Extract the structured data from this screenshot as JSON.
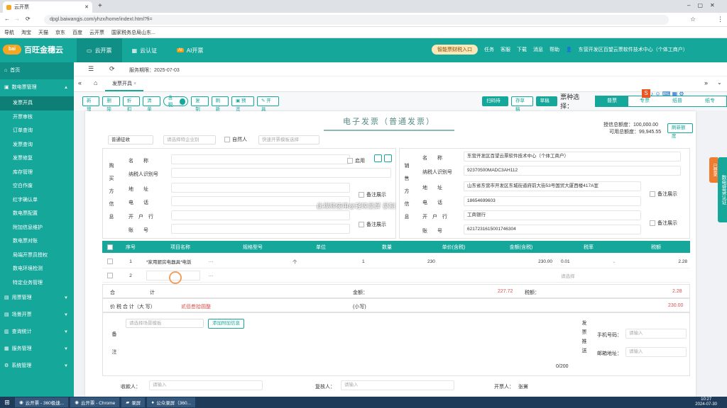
{
  "browser": {
    "tab_title": "云开票",
    "url": "dpgl.baiwangjs.com/yhzx/home/indexI.html?fi=",
    "bookmarks": [
      "导航",
      "淘宝",
      "天猫",
      "京东",
      "百度",
      "云开票",
      "国家税务总局山东..."
    ]
  },
  "app": {
    "logo_badge": "bai",
    "logo": "百旺金穗云",
    "nav": [
      "云开票",
      "云认证",
      "AI开票"
    ],
    "ai_tag": "AI",
    "smart_button": "智能票财税入口",
    "header_links": [
      "任务",
      "客服",
      "下载",
      "消息",
      "帮助"
    ],
    "company": "东营开发区百望云票软件技术中心（个体工商户）"
  },
  "sidebar": {
    "home": "首页",
    "groups": [
      {
        "label": "数电票管理",
        "items": [
          "发票开具",
          "开票审核",
          "订单查询",
          "发票查询",
          "发票修复",
          "库存管理",
          "空白作废",
          "红字确认单",
          "数电票配置",
          "附加信息维护",
          "数电票对账",
          "局端开票员授权",
          "数电环境检测",
          "特定业务管理"
        ]
      },
      {
        "label": "用票管理"
      },
      {
        "label": "场景开票"
      },
      {
        "label": "查询统计"
      },
      {
        "label": "服务管理"
      },
      {
        "label": "系统管理"
      }
    ]
  },
  "service": {
    "expiry": "服务期限：2025-07-03"
  },
  "tabs": {
    "active": "发票开具"
  },
  "toolbar": {
    "buttons": [
      "新增",
      "删除",
      "折扣",
      "清单"
    ],
    "toggle": "含税",
    "more": [
      "复制",
      "刷新"
    ],
    "preview": "预览",
    "issue": "开具",
    "right": [
      "扫码待开",
      "存草稿",
      "草稿箱"
    ],
    "kind_label": "票种选择：",
    "kinds": [
      "普票",
      "专票",
      "纸普",
      "纸专"
    ]
  },
  "invoice": {
    "title": "电子发票（普通发票）",
    "credit_total": "授信总额度：100,000.00",
    "credit_avail": "可用总额度：99,945.55",
    "refresh": "刷新额度",
    "levy": "普通征收",
    "company_select": "请选择特企业别",
    "natural_person": "自然人",
    "template_select": "快速开票模板选择",
    "buyer": {
      "section": "购买方信息",
      "fields": [
        "名　　称",
        "纳税人识别号",
        "地　　址",
        "电　　话",
        "开　户　行",
        "账　　号"
      ],
      "use_label": "启用",
      "note": "备注展示"
    },
    "seller": {
      "section": "销售方信息",
      "name": "东营开发区百望云票软件技术中心（个体工商户）",
      "taxid": "92370500MADC3AH112",
      "address": "山东省东营市开发区东城街道府前大街53号国贸大厦西楼417A室",
      "phone": "18654699603",
      "bank": "工商银行",
      "account": "6217231615001746304",
      "fields": [
        "名　　称",
        "纳税人识别号",
        "地　　址",
        "电　　话",
        "开　户　行",
        "账　　号"
      ]
    },
    "watermark": "此视频使用@轻映录屏 录制",
    "columns": [
      "序号",
      "项目名称",
      "规格型号",
      "单位",
      "数量",
      "单价(含税)",
      "金额(含税)",
      "税率",
      "税额"
    ],
    "rows": [
      {
        "no": "1",
        "name": "*家用厨房电器具*电饭",
        "spec": "",
        "unit": "个",
        "qty": "1",
        "price": "230",
        "amount": "230.00",
        "rate": "0.01",
        "tax": "2.28"
      },
      {
        "no": "2",
        "name": "",
        "spec": "",
        "unit": "",
        "qty": "",
        "price": "",
        "amount": "",
        "rate": "请选择",
        "tax": ""
      }
    ],
    "total_label": "合　　　　　　　计",
    "amount_label": "金额：",
    "amount": "227.72",
    "tax_label": "税额：",
    "tax": "2.28",
    "grand_label": "价 税 合 计（大 写）",
    "grand_cn": "贰佰叁拾圆整",
    "small_label": "(小写)",
    "grand": "230.00",
    "remark_label": "备注",
    "remark_select": "请选择场景模板",
    "add_info": "添加附加信息",
    "counter": "0/200",
    "push_label": "发票推送",
    "phone_label": "手机号码：",
    "phone_ph": "请输入",
    "email_label": "邮箱地址：",
    "email_ph": "请输入",
    "receiver_label": "收款人：",
    "reviewer_label": "复核人：",
    "issuer_label": "开票人：",
    "issuer": "张黉",
    "input_ph": "请输入",
    "side_tabs": [
      "已登录",
      "数电登录认证"
    ]
  },
  "taskbar": {
    "items": [
      "云开票 - 360极速...",
      "云开票 - Chrome",
      "录屏",
      "公众录屏（360..."
    ],
    "time": "10:27",
    "date": "2024-07-30"
  }
}
